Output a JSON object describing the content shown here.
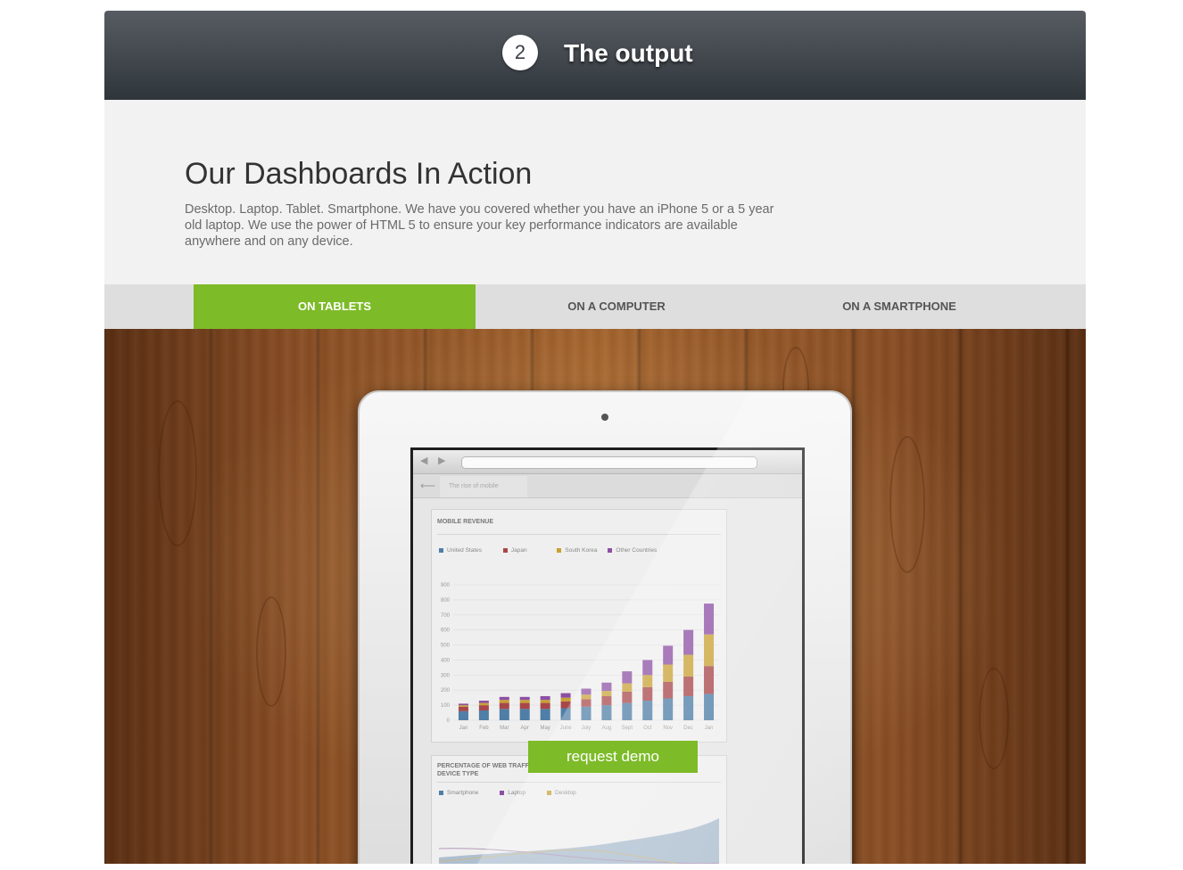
{
  "header": {
    "step_number": "2",
    "title": "The output"
  },
  "intro": {
    "title": "Our Dashboards In Action",
    "text": "Desktop. Laptop. Tablet. Smartphone. We have you covered whether you have an iPhone 5 or a 5 year old laptop. We use the power of HTML 5 to ensure your key performance indicators are available anywhere and on any device."
  },
  "tabs": [
    {
      "label": "ON TABLETS",
      "active": true
    },
    {
      "label": "ON A COMPUTER",
      "active": false
    },
    {
      "label": "ON A SMARTPHONE",
      "active": false
    }
  ],
  "colors": {
    "accent": "#7dbb28",
    "header_dark": "#2f363b"
  },
  "tablet_screen": {
    "page_tab": "The rise of mobile",
    "revenue_card": {
      "title": "MOBILE REVENUE",
      "legend": [
        {
          "label": "United States",
          "color": "#4f7ea6"
        },
        {
          "label": "Japan",
          "color": "#a8474a"
        },
        {
          "label": "South Korea",
          "color": "#c8a134"
        },
        {
          "label": "Other Countries",
          "color": "#8c4fa3"
        }
      ]
    },
    "traffic_card": {
      "title_line1": "PERCENTAGE OF WEB TRAFFIC BY",
      "title_line2": "DEVICE TYPE",
      "legend": [
        {
          "label": "Smartphone",
          "color": "#4f7ea6"
        },
        {
          "label": "Laptop",
          "color": "#8c4fa3"
        },
        {
          "label": "Desktop",
          "color": "#c8a134"
        }
      ]
    }
  },
  "cta": {
    "label": "request demo"
  },
  "chart_data": {
    "type": "bar",
    "title": "MOBILE REVENUE",
    "stacked": true,
    "categories": [
      "Jan",
      "Feb",
      "Mar",
      "Apr",
      "May",
      "June",
      "July",
      "Aug",
      "Sept",
      "Oct",
      "Nov",
      "Dec",
      "Jan"
    ],
    "yticks": [
      0,
      100,
      200,
      300,
      400,
      500,
      600,
      700,
      800,
      900
    ],
    "ylim": [
      0,
      900
    ],
    "series": [
      {
        "name": "United States",
        "values": [
          60,
          65,
          75,
          75,
          75,
          80,
          90,
          100,
          115,
          130,
          145,
          160,
          175
        ]
      },
      {
        "name": "Japan",
        "values": [
          30,
          35,
          40,
          40,
          40,
          45,
          50,
          60,
          75,
          90,
          110,
          130,
          185
        ]
      },
      {
        "name": "South Korea",
        "values": [
          10,
          15,
          20,
          20,
          20,
          25,
          30,
          35,
          55,
          80,
          115,
          145,
          210
        ]
      },
      {
        "name": "Other Countries",
        "values": [
          10,
          15,
          20,
          20,
          25,
          30,
          40,
          55,
          80,
          100,
          125,
          165,
          205
        ]
      }
    ]
  }
}
